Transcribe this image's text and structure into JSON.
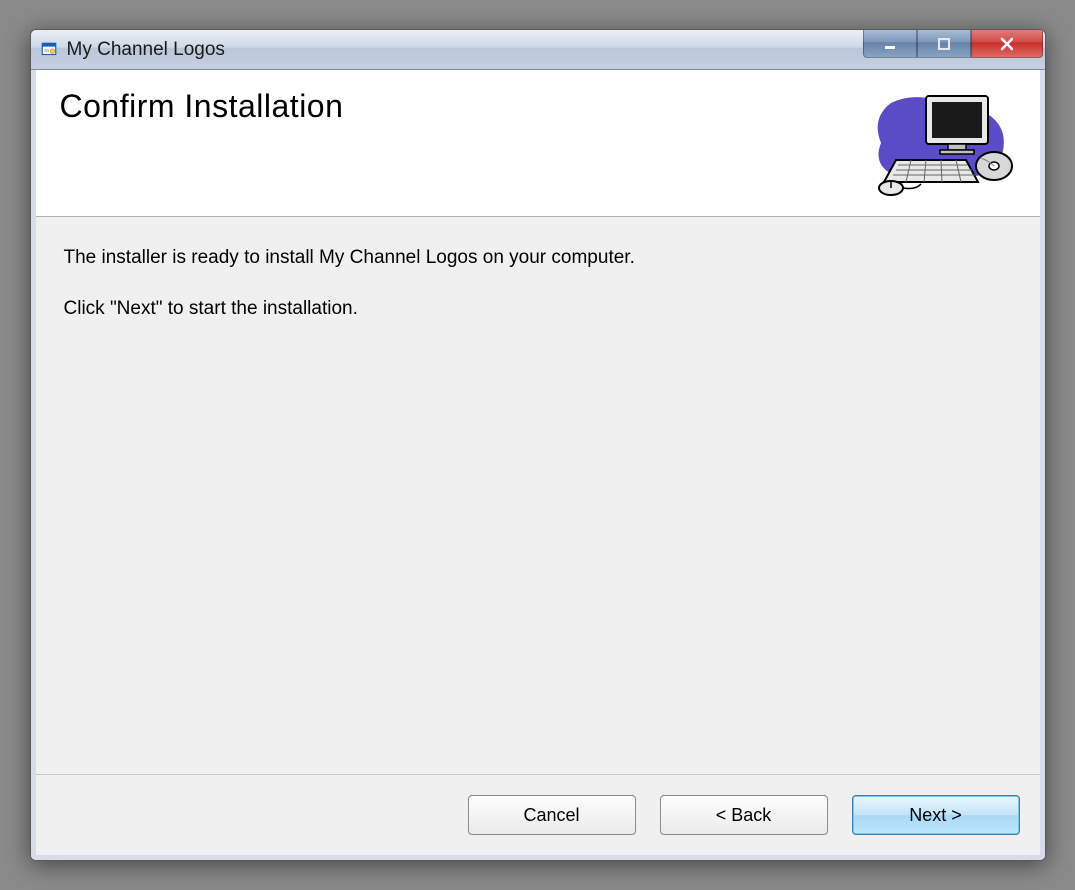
{
  "titlebar": {
    "title": "My Channel Logos"
  },
  "header": {
    "title": "Confirm Installation"
  },
  "body": {
    "line1": "The installer is ready to install My Channel Logos on your computer.",
    "line2": "Click \"Next\" to start the installation."
  },
  "buttons": {
    "cancel": "Cancel",
    "back": "< Back",
    "next": "Next >"
  }
}
